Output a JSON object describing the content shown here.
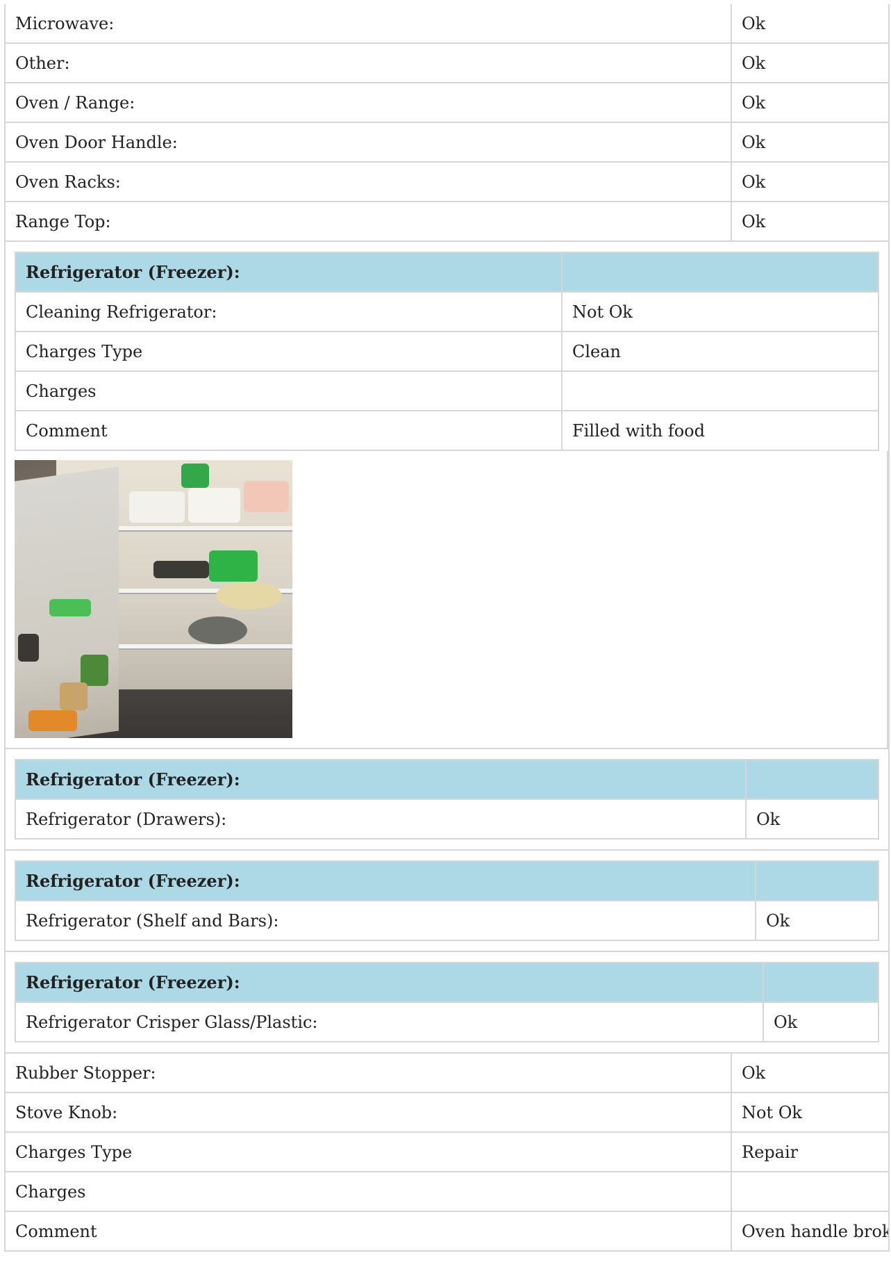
{
  "top_rows": [
    {
      "label": "Microwave:",
      "value": "Ok"
    },
    {
      "label": "Other:",
      "value": "Ok"
    },
    {
      "label": "Oven / Range:",
      "value": "Ok"
    },
    {
      "label": "Oven Door Handle:",
      "value": "Ok"
    },
    {
      "label": "Oven Racks:",
      "value": "Ok"
    },
    {
      "label": "Range Top:",
      "value": "Ok"
    }
  ],
  "group1": {
    "header": "Refrigerator (Freezer):",
    "rows": [
      {
        "label": "Cleaning Refrigerator:",
        "value": "Not Ok"
      },
      {
        "label": "Charges Type",
        "value": "Clean"
      },
      {
        "label": "Charges",
        "value": ""
      },
      {
        "label": "Comment",
        "value": "Filled with food"
      }
    ]
  },
  "group2": {
    "header": "Refrigerator (Freezer):",
    "rows": [
      {
        "label": "Refrigerator (Drawers):",
        "value": "Ok"
      }
    ]
  },
  "group3": {
    "header": "Refrigerator (Freezer):",
    "rows": [
      {
        "label": "Refrigerator (Shelf and Bars):",
        "value": "Ok"
      }
    ]
  },
  "group4": {
    "header": "Refrigerator (Freezer):",
    "rows": [
      {
        "label": "Refrigerator Crisper Glass/Plastic:",
        "value": "Ok"
      }
    ]
  },
  "bottom_rows": [
    {
      "label": "Rubber Stopper:",
      "value": "Ok"
    },
    {
      "label": "Stove Knob:",
      "value": "Not Ok"
    },
    {
      "label": "Charges Type",
      "value": "Repair"
    },
    {
      "label": "Charges",
      "value": ""
    },
    {
      "label": "Comment",
      "value": "Oven handle broke"
    }
  ]
}
